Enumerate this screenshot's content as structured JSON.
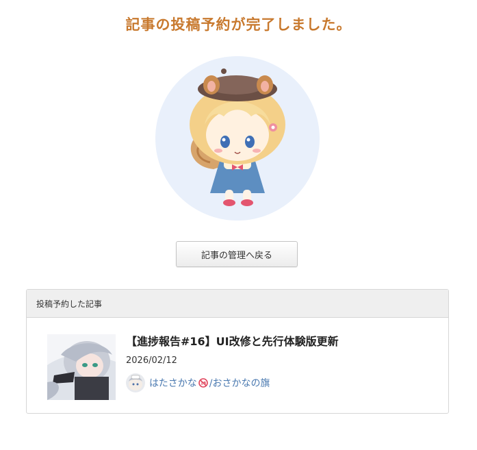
{
  "page": {
    "headline": "記事の投稿予約が完了しました。"
  },
  "actions": {
    "back_label": "記事の管理へ戻る"
  },
  "panel": {
    "header": "投稿予約した記事"
  },
  "article": {
    "title": "【進捗報告#16】UI改修と先行体験版更新",
    "date": "2026/02/12",
    "author_name": "はたさかな",
    "author_suffix": "/おさかなの旗"
  },
  "colors": {
    "headline": "#c8792e",
    "link": "#4a79b0",
    "mascot_bg": "#e9f0fb"
  },
  "icons": {
    "mascot": "squirrel-girl-illustration",
    "thumbnail": "article-thumbnail",
    "avatar": "author-avatar",
    "badge": "no-18-icon"
  }
}
